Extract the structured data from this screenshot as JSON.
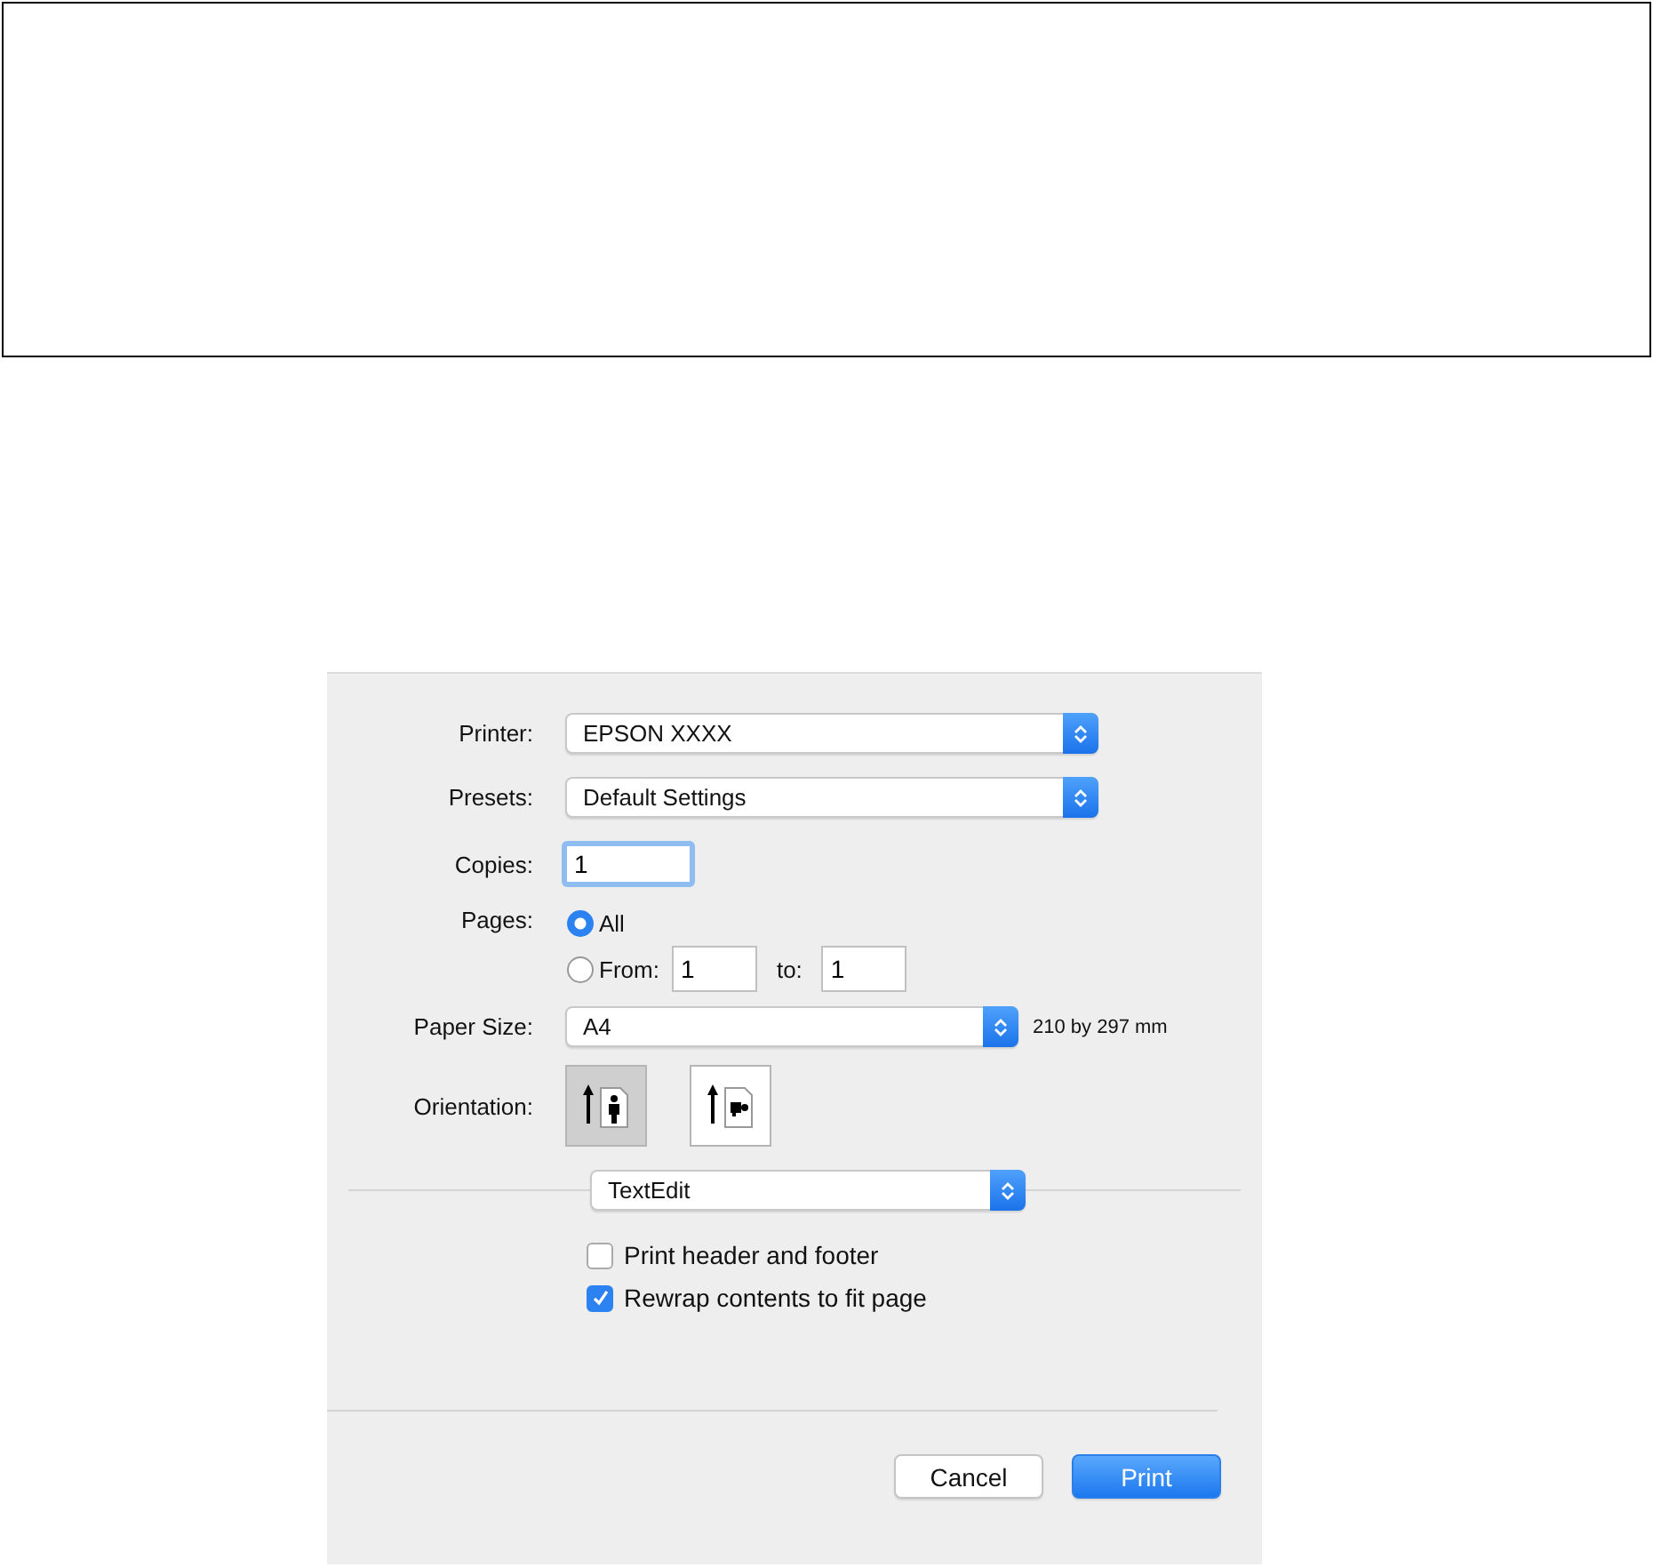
{
  "dialog": {
    "printer": {
      "label": "Printer:",
      "value": "EPSON XXXX"
    },
    "presets": {
      "label": "Presets:",
      "value": "Default Settings"
    },
    "copies": {
      "label": "Copies:",
      "value": "1"
    },
    "pages": {
      "label": "Pages:",
      "options": [
        {
          "label": "All",
          "selected": true
        },
        {
          "label": "From:",
          "selected": false,
          "from": "1",
          "to_label": "to:",
          "to": "1"
        }
      ]
    },
    "paper_size": {
      "label": "Paper Size:",
      "value": "A4",
      "note": "210 by 297 mm"
    },
    "orientation": {
      "label": "Orientation:",
      "options": [
        {
          "kind": "portrait",
          "selected": true
        },
        {
          "kind": "landscape",
          "selected": false
        }
      ]
    },
    "app_menu": {
      "value": "TextEdit"
    },
    "checkboxes": [
      {
        "label": "Print header and footer",
        "checked": false
      },
      {
        "label": "Rewrap contents to fit page",
        "checked": true
      }
    ],
    "buttons": [
      {
        "label": "Cancel",
        "kind": "normal"
      },
      {
        "label": "Print",
        "kind": "default"
      }
    ]
  }
}
